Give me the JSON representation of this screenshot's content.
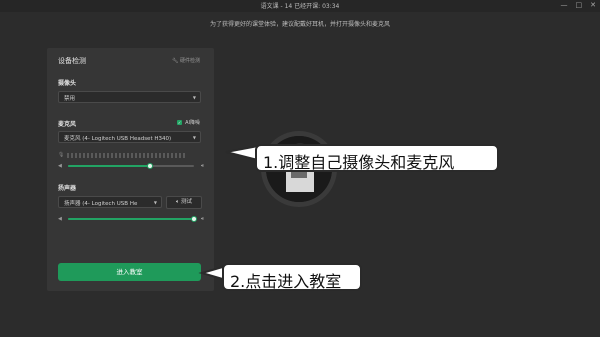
{
  "window": {
    "title": "语文课 - 14   已经开课: 03:34",
    "controls": [
      "—",
      "□",
      "✕"
    ]
  },
  "hint": "为了获得更好的课堂体验，建议配戴好耳机，并打开摄像头和麦克风",
  "panel": {
    "title": "设备检测",
    "hw_label": "硬件检测",
    "camera": {
      "label": "摄像头",
      "value": "禁用"
    },
    "mic": {
      "label": "麦克风",
      "ai_label": "AI降噪",
      "ai_checked": true,
      "value": "麦克风 (4- Logitech USB Headset H340)",
      "volume_fraction": 0.65
    },
    "speaker": {
      "label": "扬声器",
      "value": "扬声器 (4- Logitech USB He",
      "test_label": "测试",
      "volume_fraction": 1.0
    },
    "enter_label": "进入教室"
  },
  "callouts": {
    "one": "1.调整自己摄像头和麦克风",
    "two": "2.点击进入教室"
  },
  "colors": {
    "accent": "#1f9a5a",
    "background": "#2c2c2c",
    "panel": "#363636"
  }
}
